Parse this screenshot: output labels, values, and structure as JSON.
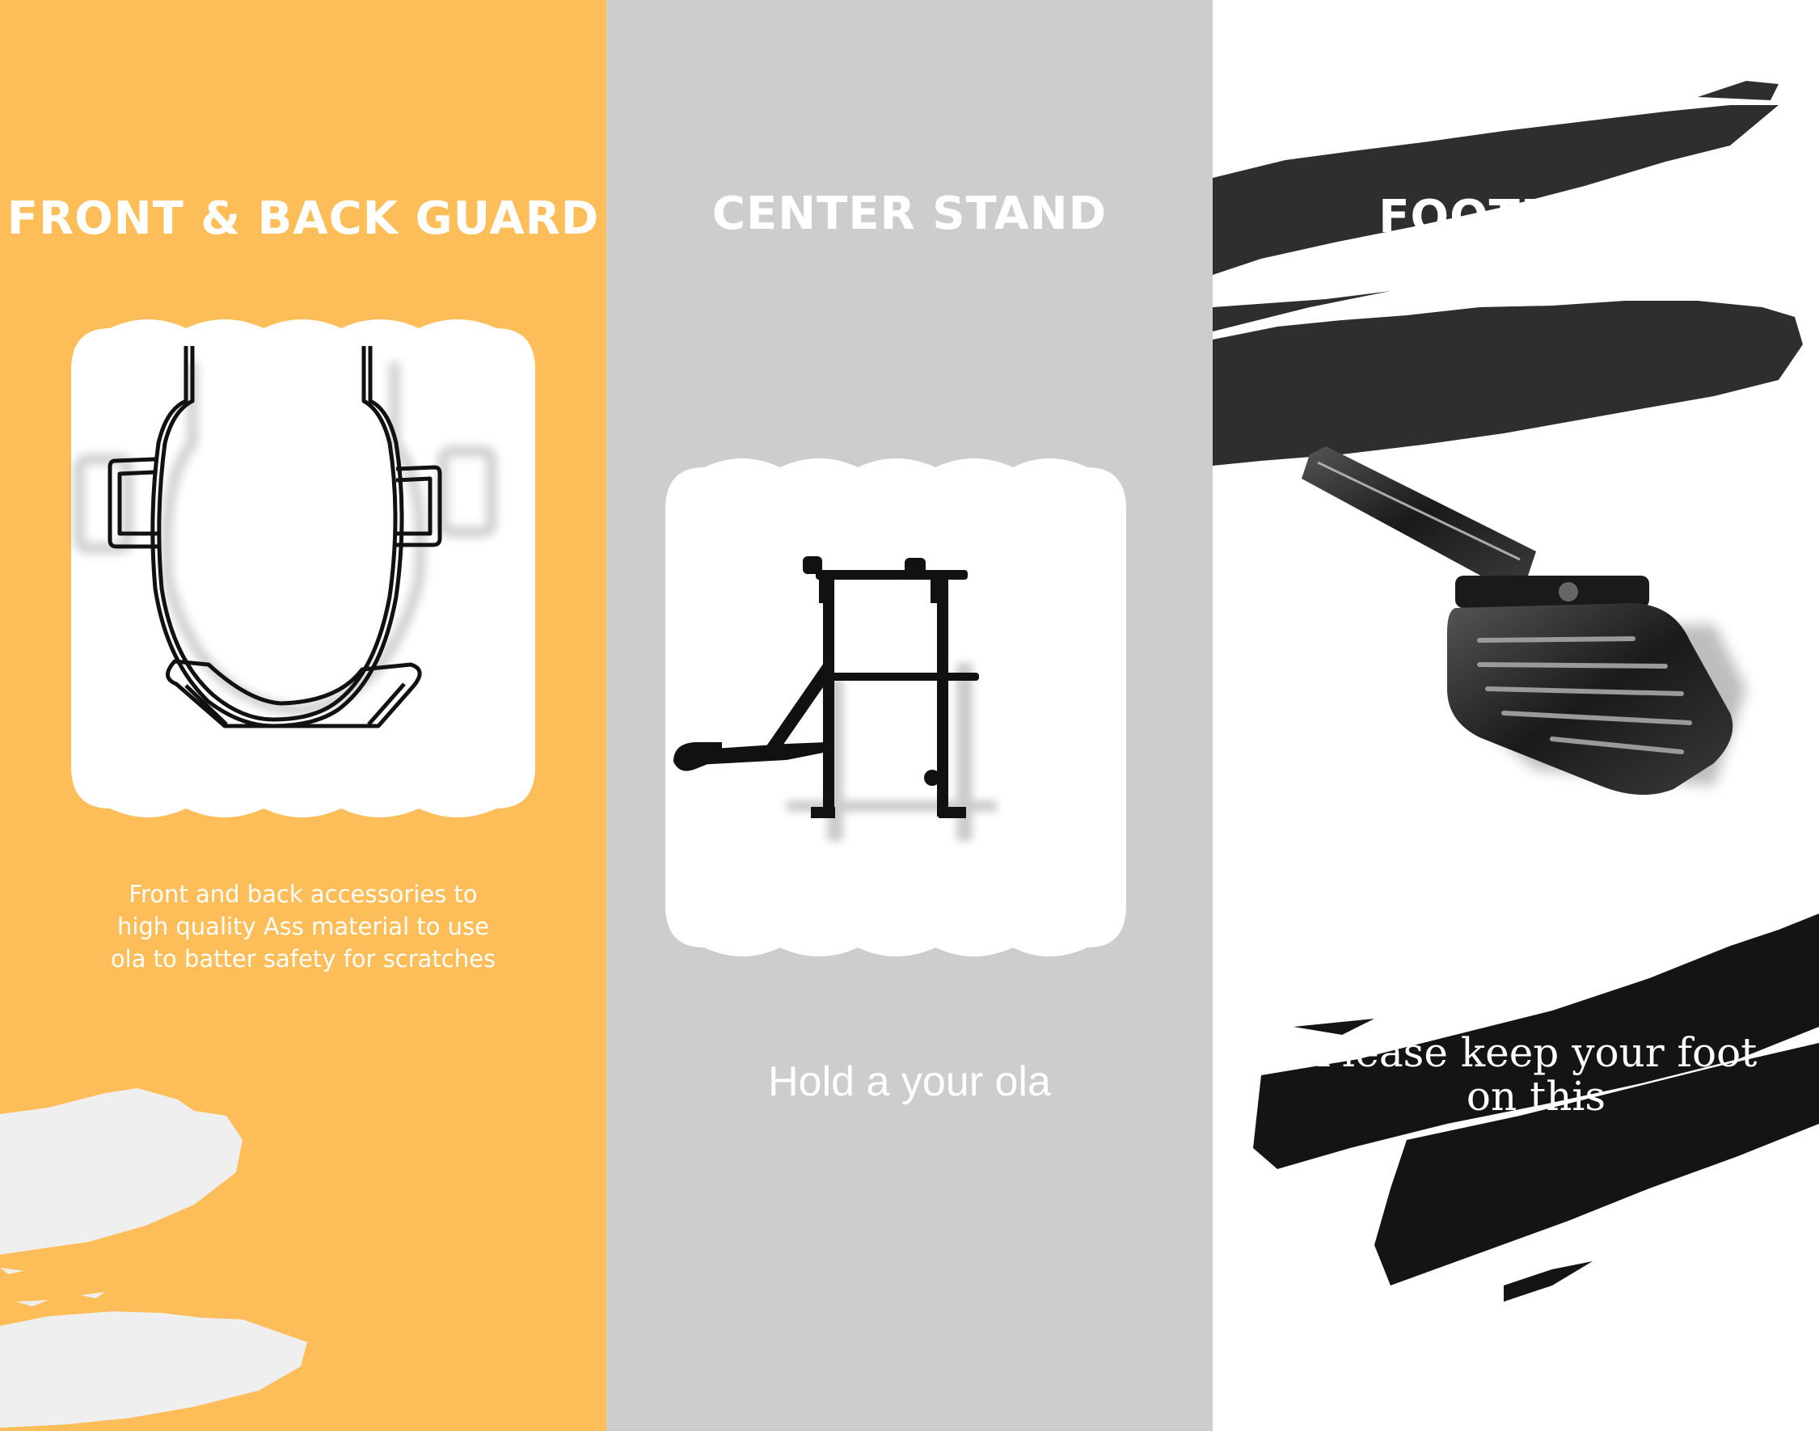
{
  "colors": {
    "panel1": "#FDBE5A",
    "panel2": "#CDCDCD",
    "panel3": "#FFFFFF",
    "ink": "#1A1A1A",
    "chalk": "#EFEFEF"
  },
  "panels": [
    {
      "title": "FRONT & BACK GUARD",
      "image": "front-back-guard-photo",
      "description": [
        "Front and back accessories  to",
        "high quality  Ass  material to use",
        "ola to batter safety for scratches"
      ]
    },
    {
      "title": "CENTER STAND",
      "image": "center-stand-photo",
      "caption": "Hold a your ola"
    },
    {
      "title": "FOOTREST",
      "image": "footrest-photo",
      "caption_lines": [
        "Please keep your foot",
        "on this"
      ]
    }
  ]
}
